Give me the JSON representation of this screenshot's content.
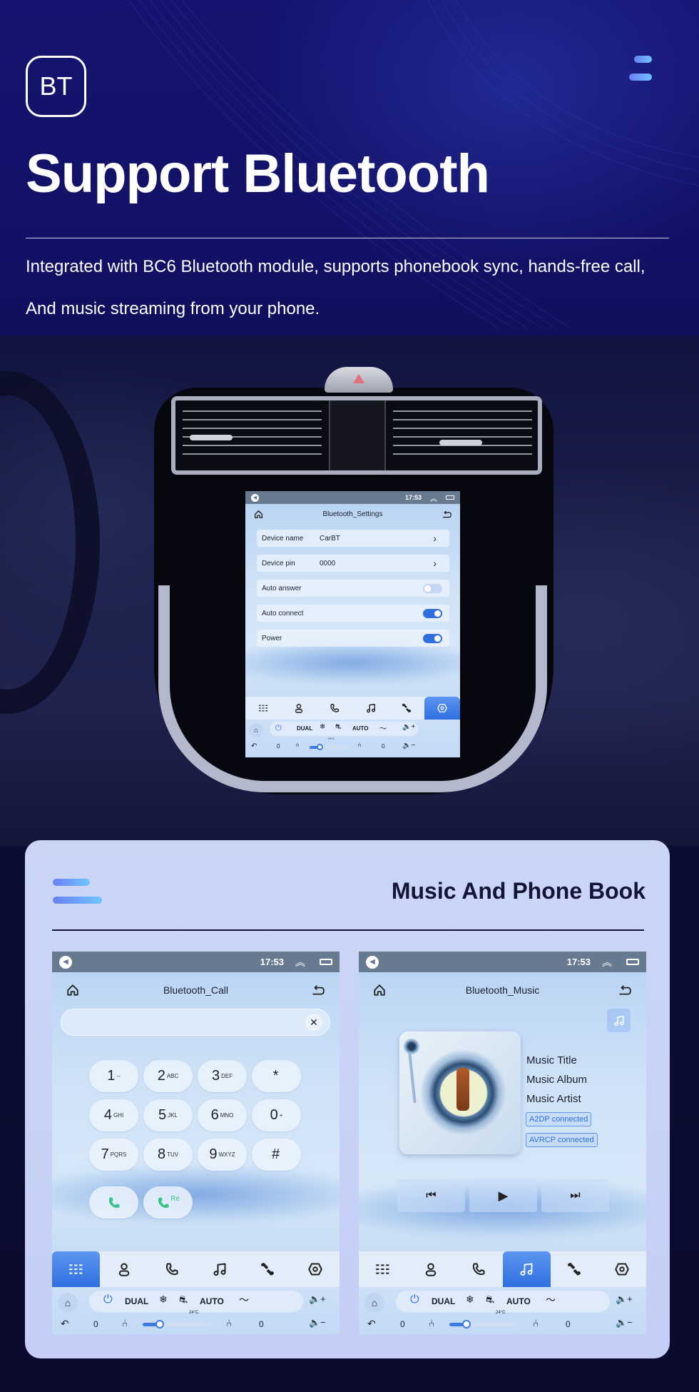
{
  "hero": {
    "badge": "BT",
    "title": "Support Bluetooth",
    "description_lines": [
      "Integrated with BC6 Bluetooth module, supports phonebook sync, hands-free call,",
      "And music streaming from your phone."
    ]
  },
  "status_bar": {
    "time": "17:53"
  },
  "settings_screen": {
    "title": "Bluetooth_Settings",
    "rows": [
      {
        "label": "Device name",
        "value": "CarBT",
        "type": "link"
      },
      {
        "label": "Device pin",
        "value": "0000",
        "type": "link"
      },
      {
        "label": "Auto answer",
        "type": "toggle",
        "on": false
      },
      {
        "label": "Auto connect",
        "type": "toggle",
        "on": true
      },
      {
        "label": "Power",
        "type": "toggle",
        "on": true
      }
    ],
    "active_tab": "settings"
  },
  "tabs": [
    "dialpad",
    "contacts",
    "call-log",
    "music",
    "link",
    "settings"
  ],
  "climate": {
    "dual": "DUAL",
    "auto": "AUTO",
    "temp": "24°C",
    "left_seat_level": "0",
    "right_seat_level": "0",
    "fan_level_fraction": 0.25
  },
  "panel": {
    "title": "Music And Phone Book"
  },
  "call_screen": {
    "title": "Bluetooth_Call",
    "input_value": "",
    "keys": [
      {
        "d": "1",
        "s": "--"
      },
      {
        "d": "2",
        "s": "ABC"
      },
      {
        "d": "3",
        "s": "DEF"
      },
      {
        "d": "*",
        "s": ""
      },
      {
        "d": "4",
        "s": "GHI"
      },
      {
        "d": "5",
        "s": "JKL"
      },
      {
        "d": "6",
        "s": "MNO"
      },
      {
        "d": "0",
        "s": "+"
      },
      {
        "d": "7",
        "s": "PQRS"
      },
      {
        "d": "8",
        "s": "TUV"
      },
      {
        "d": "9",
        "s": "WXYZ"
      },
      {
        "d": "#",
        "s": ""
      }
    ],
    "redial_label": "Re",
    "active_tab": "dialpad"
  },
  "music_screen": {
    "title": "Bluetooth_Music",
    "track_title": "Music Title",
    "album": "Music Album",
    "artist": "Music Artist",
    "chips": [
      "A2DP  connected",
      "AVRCP connected"
    ],
    "active_tab": "music"
  },
  "colors": {
    "accent": "#2f6fe0",
    "status_bar": "#687a90",
    "call_green": "#3cc28a",
    "hero_bg": "#121166",
    "panel_bg": "#cbd6f7"
  }
}
